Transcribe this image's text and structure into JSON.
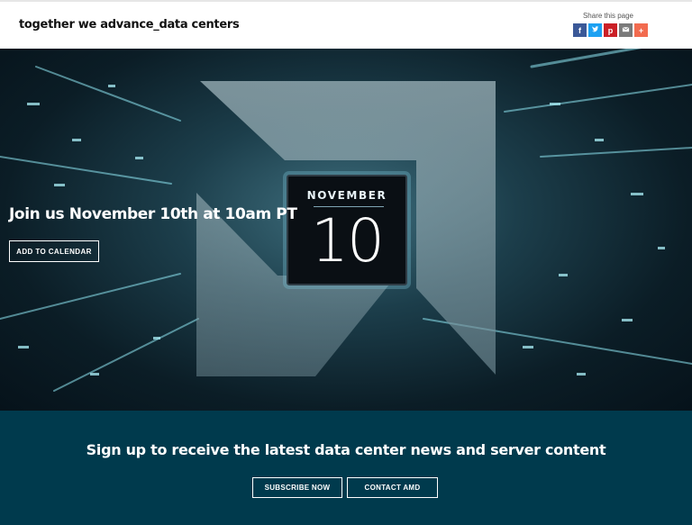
{
  "header": {
    "brand": "together we advance_data centers",
    "share_label": "Share this page",
    "share_buttons": [
      {
        "icon": "facebook-icon",
        "glyph": "f",
        "color": "#3b5998"
      },
      {
        "icon": "twitter-icon",
        "glyph": "t",
        "color": "#1da1f2"
      },
      {
        "icon": "pinterest-icon",
        "glyph": "p",
        "color": "#cb2027"
      },
      {
        "icon": "email-icon",
        "glyph": "",
        "color": "#7a7a7a"
      },
      {
        "icon": "more-plus-icon",
        "glyph": "+",
        "color": "#f26b4f"
      }
    ]
  },
  "hero": {
    "calendar_month": "NOVEMBER",
    "calendar_day": "10",
    "title": "Join us November 10th at 10am PT",
    "button_label": "ADD TO CALENDAR"
  },
  "signup": {
    "title": "Sign up to receive the latest data center news and server content",
    "subscribe_label": "SUBSCRIBE NOW",
    "contact_label": "CONTACT AMD"
  },
  "colors": {
    "band": "#003a4d",
    "accent_cyan": "#6fd6e6"
  }
}
